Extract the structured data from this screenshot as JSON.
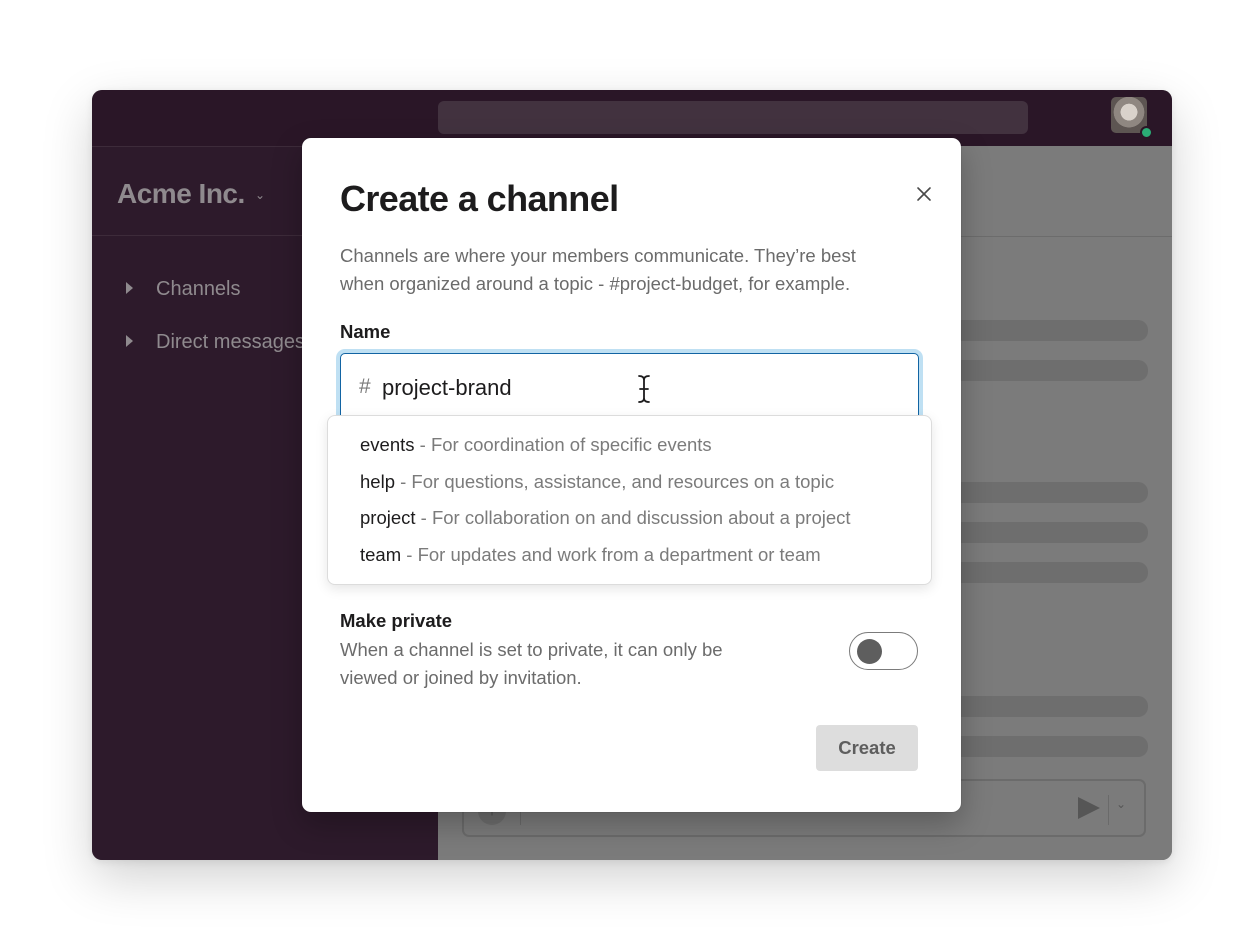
{
  "workspace": {
    "name": "Acme Inc.",
    "chevron": "⌄"
  },
  "sidebar": {
    "items": [
      {
        "label": "Channels",
        "icon": "caret-right-icon"
      },
      {
        "label": "Direct messages",
        "icon": "caret-right-icon"
      }
    ]
  },
  "composer": {
    "attach_glyph": "+",
    "send_chevron": "⌄"
  },
  "modal": {
    "title": "Create a channel",
    "description": "Channels are where your members communicate. They’re best when organized around a topic - #project-budget, for example.",
    "name_label": "Name",
    "name_prefix": "#",
    "name_value": "project-brand",
    "suggestions": [
      {
        "name": "events",
        "description": " - For coordination of specific events"
      },
      {
        "name": "help",
        "description": " - For questions, assistance, and resources on a topic"
      },
      {
        "name": "project",
        "description": " - For collaboration on and discussion about a project"
      },
      {
        "name": "team",
        "description": " - For updates and work from a department or team"
      }
    ],
    "private_label": "Make private",
    "private_description": "When a channel is set to private, it can only be viewed or joined by invitation.",
    "private_enabled": false,
    "create_label": "Create"
  },
  "colors": {
    "topbar": "#2a1627",
    "sidebar": "#2d1a2b",
    "presence": "#2bac76",
    "focus_ring": "#bfe0f3",
    "focus_border": "#1264a3"
  }
}
